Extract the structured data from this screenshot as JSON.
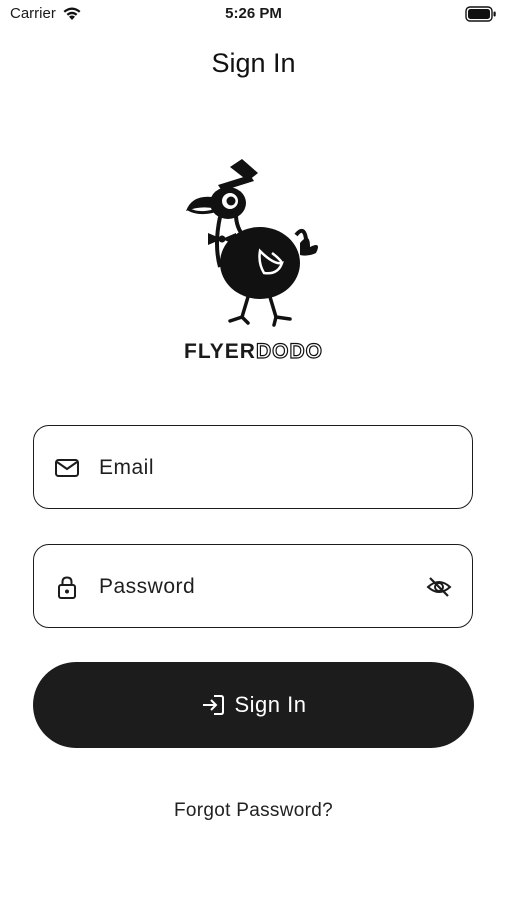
{
  "status_bar": {
    "carrier": "Carrier",
    "time": "5:26 PM",
    "wifi_icon": "wifi-icon",
    "battery_icon": "battery-icon"
  },
  "header": {
    "title": "Sign In"
  },
  "logo": {
    "text_part1": "FLYER",
    "text_part2": "DODO",
    "icon": "dodo-mascot-logo"
  },
  "form": {
    "email": {
      "placeholder": "Email",
      "icon": "mail-icon"
    },
    "password": {
      "placeholder": "Password",
      "icon": "lock-icon",
      "toggle_icon": "eye-off-icon"
    },
    "submit": {
      "label": "Sign In",
      "icon": "login-icon"
    },
    "forgot_link": "Forgot Password?"
  },
  "colors": {
    "primary": "#1c1c1c",
    "background": "#ffffff",
    "button_text": "#ffffff"
  }
}
